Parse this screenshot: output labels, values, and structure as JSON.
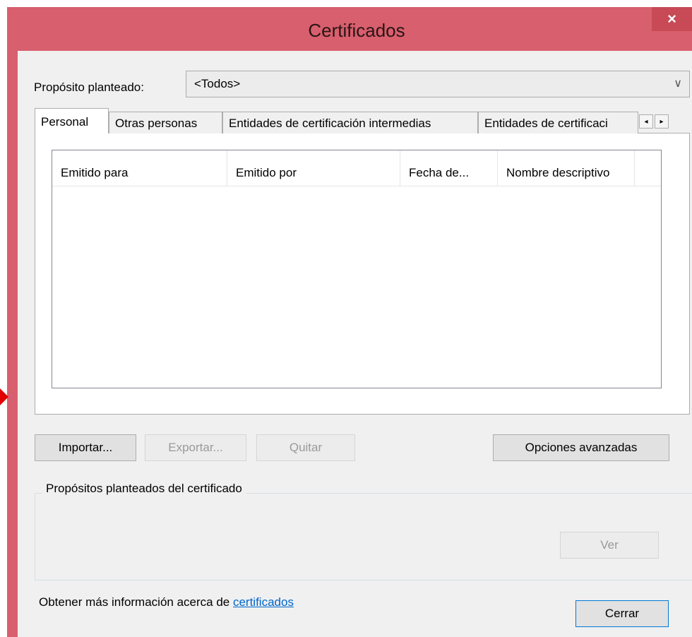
{
  "window": {
    "title": "Certificados",
    "close_glyph": "×"
  },
  "purpose": {
    "label": "Propósito planteado:",
    "value": "<Todos>"
  },
  "tabs": [
    {
      "label": "Personal"
    },
    {
      "label": "Otras personas"
    },
    {
      "label": "Entidades de certificación intermedias"
    },
    {
      "label": "Entidades de certificaci"
    }
  ],
  "tab_scroll": {
    "left": "◂",
    "right": "▸"
  },
  "table": {
    "columns": [
      "Emitido para",
      "Emitido por",
      "Fecha de...",
      "Nombre descriptivo"
    ]
  },
  "buttons": {
    "import": "Importar...",
    "export": "Exportar...",
    "remove": "Quitar",
    "advanced": "Opciones avanzadas",
    "view": "Ver",
    "close": "Cerrar"
  },
  "group": {
    "label": "Propósitos planteados del certificado"
  },
  "footer": {
    "text": "Obtener más información acerca de ",
    "link": "certificados"
  },
  "colors": {
    "title_bar": "#d85f6d",
    "close_button": "#c74a56",
    "link": "#0066cc",
    "arrow": "#e00000"
  }
}
